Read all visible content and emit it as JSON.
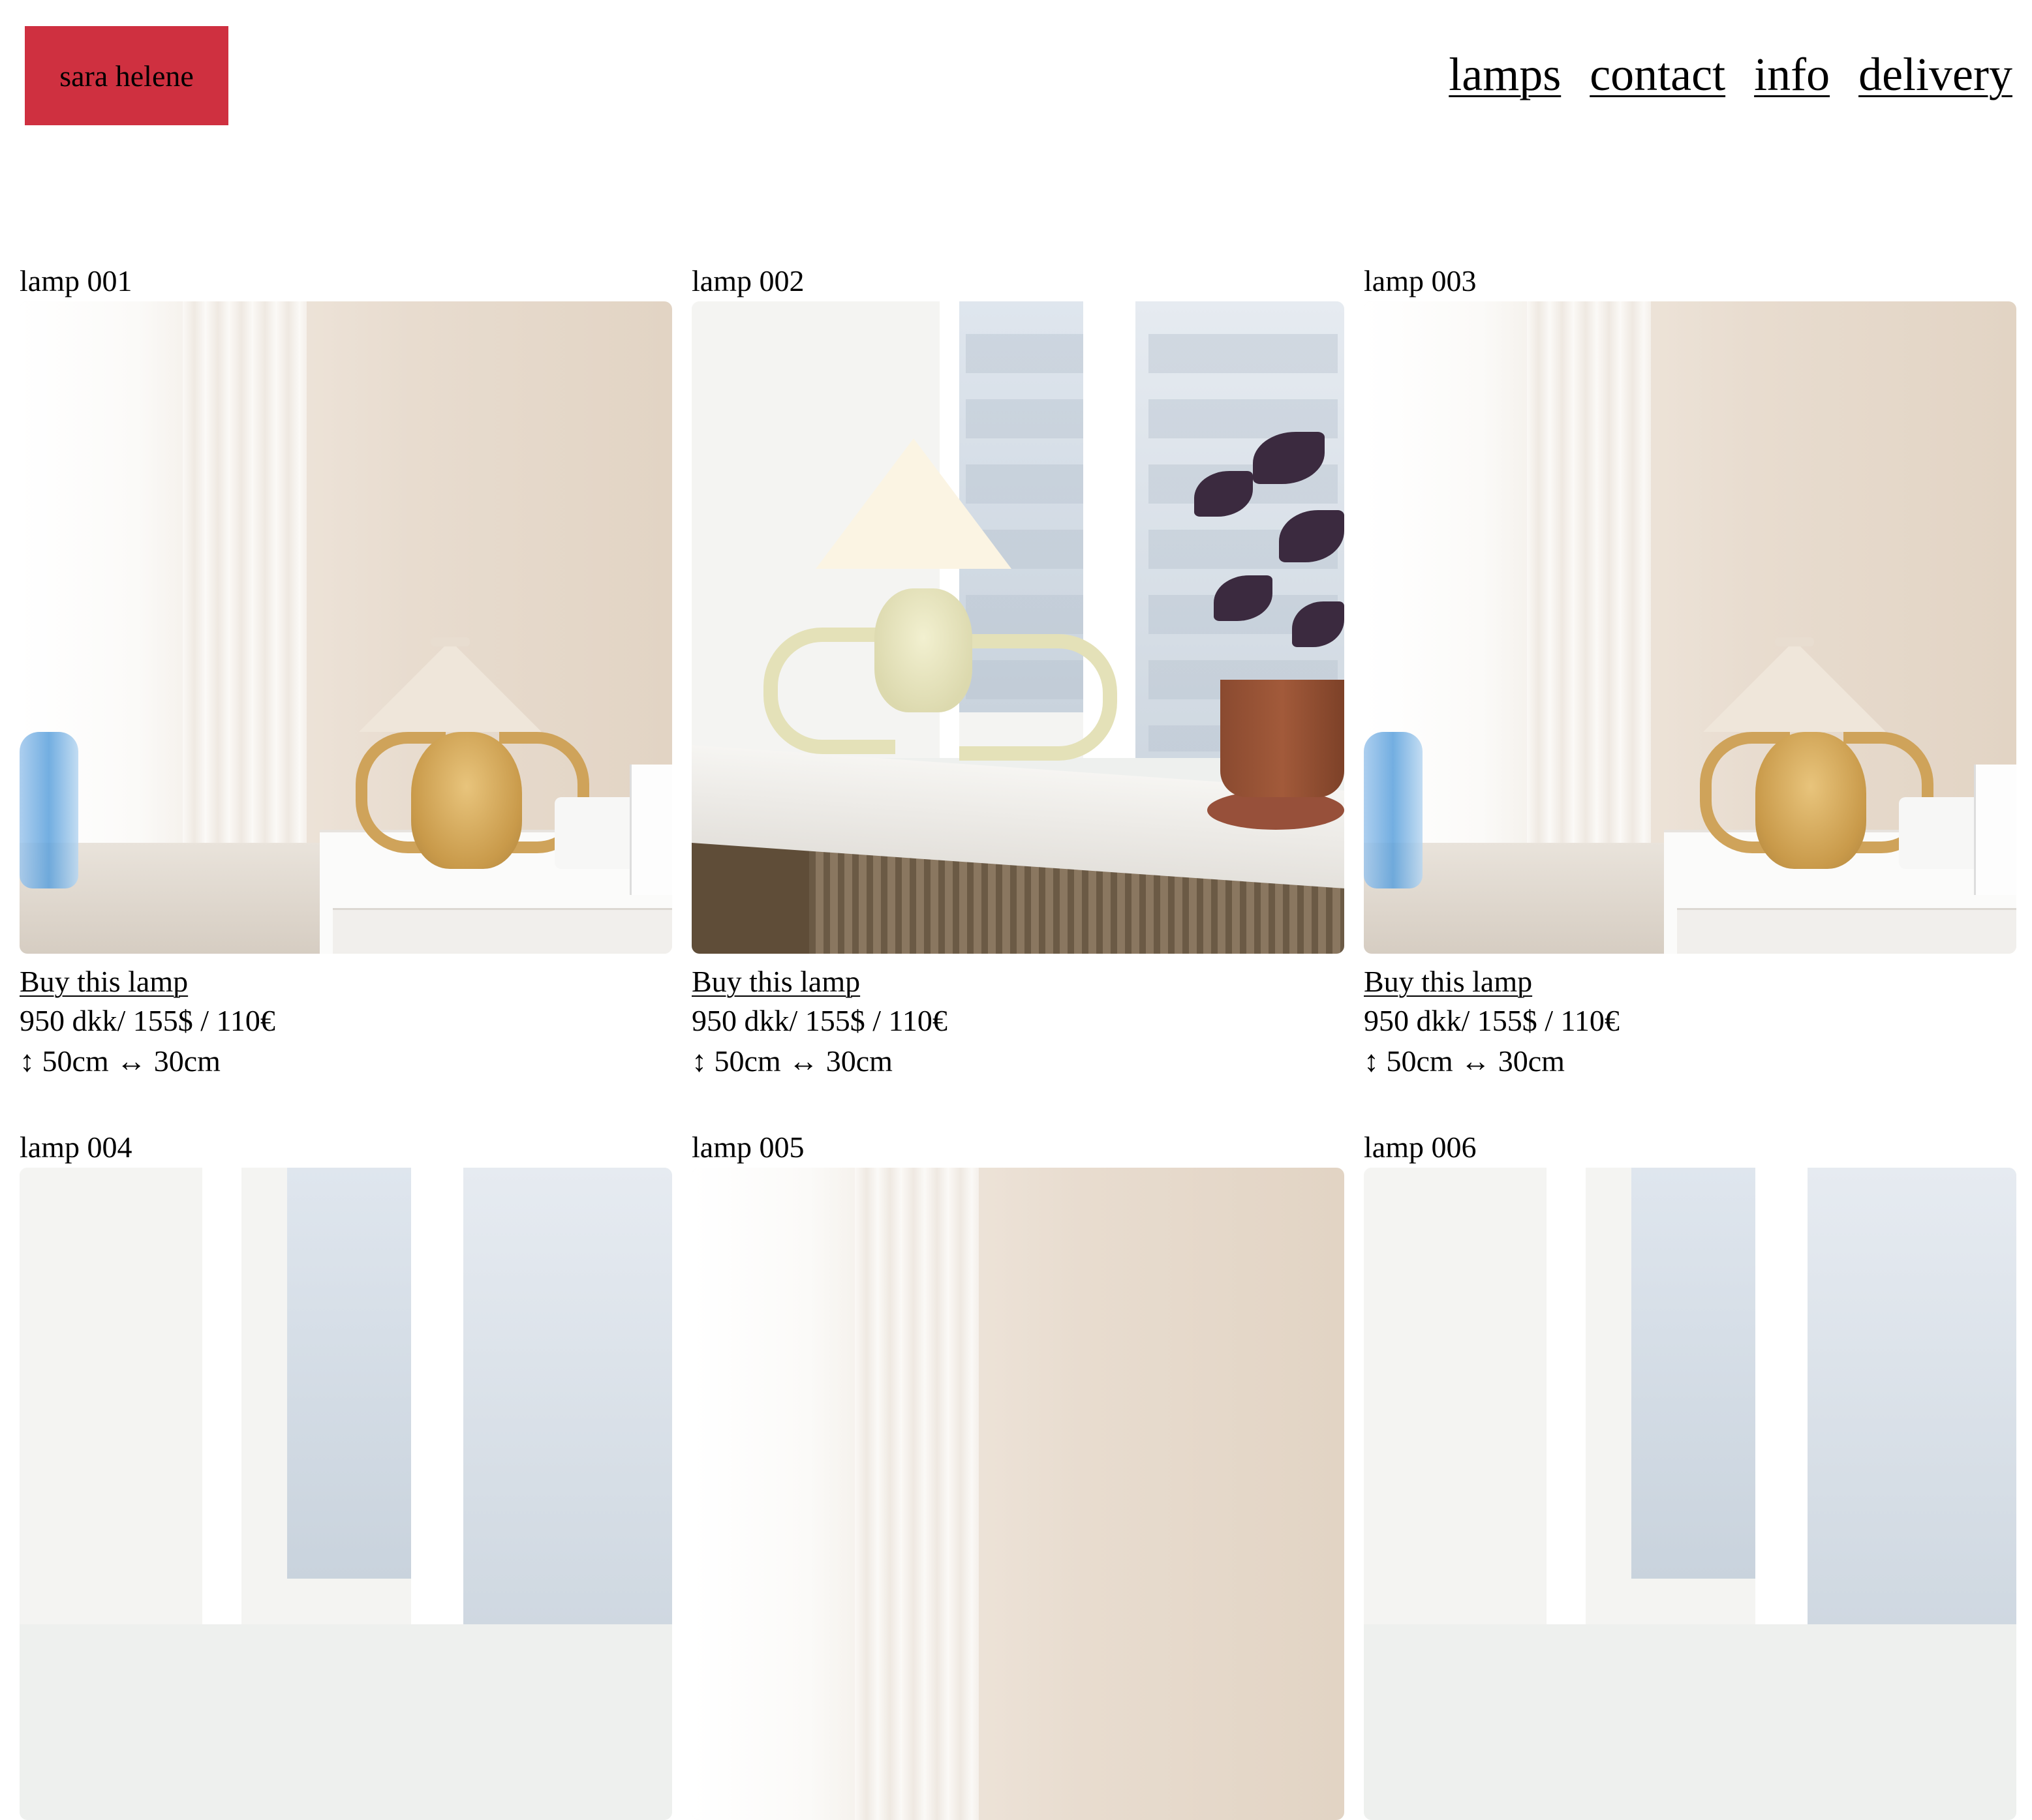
{
  "brand": {
    "name": "sara helene",
    "color": "#cf3040"
  },
  "nav": [
    {
      "label": "lamps"
    },
    {
      "label": "contact"
    },
    {
      "label": "info"
    },
    {
      "label": "delivery"
    }
  ],
  "products": [
    {
      "title": "lamp 001",
      "buy_label": "Buy this lamp",
      "price": "950 dkk/ 155$ / 110€",
      "size": "↕ 50cm ↔ 30cm",
      "photo": "lamp-vase-on-piano"
    },
    {
      "title": "lamp 002",
      "buy_label": "Buy this lamp",
      "price": "950 dkk/ 155$ / 110€",
      "size": "↕ 50cm ↔ 30cm",
      "photo": "lamp-on-windowsill-with-plant"
    },
    {
      "title": "lamp 003",
      "buy_label": "Buy this lamp",
      "price": "950 dkk/ 155$ / 110€",
      "size": "↕ 50cm ↔ 30cm",
      "photo": "lamp-vase-on-piano"
    },
    {
      "title": "lamp 004",
      "photo": "window-view"
    },
    {
      "title": "lamp 005",
      "photo": "warm-wall"
    },
    {
      "title": "lamp 006",
      "photo": "window-view"
    }
  ]
}
